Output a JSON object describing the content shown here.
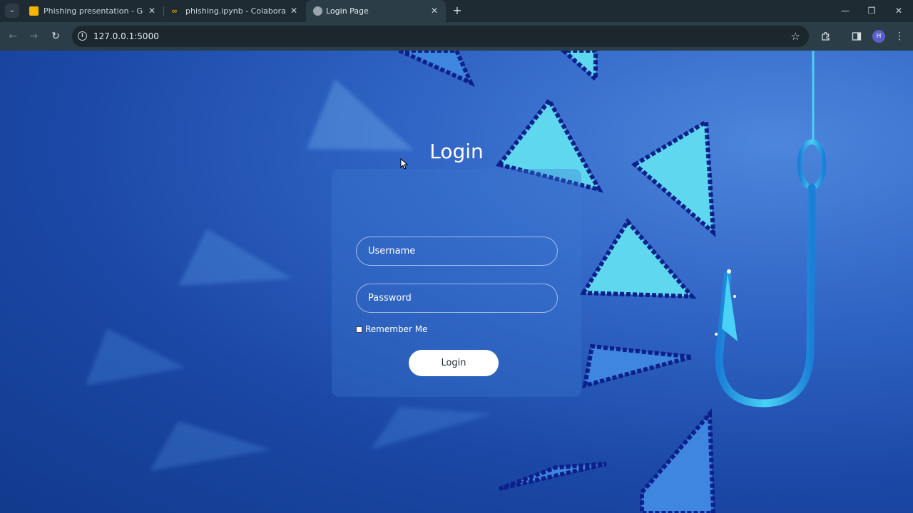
{
  "browser": {
    "tabs": [
      {
        "title": "Phishing presentation - Google",
        "favicon_color": "#f4b400",
        "active": false
      },
      {
        "title": "phishing.ipynb - Colaboratory",
        "favicon_color": "#f9ab00",
        "active": false
      },
      {
        "title": "Login Page",
        "favicon_color": "#9aa6ae",
        "active": true
      }
    ],
    "address": "127.0.0.1:5000",
    "profile_initial": "H"
  },
  "login": {
    "title": "Login",
    "username_placeholder": "Username",
    "password_placeholder": "Password",
    "remember_label": "Remember Me",
    "submit_label": "Login"
  },
  "icons": {
    "tab_search": "chevron-down-icon",
    "back": "arrow-left-icon",
    "forward": "arrow-right-icon",
    "reload": "reload-icon",
    "site_info": "info-icon",
    "bookmark": "star-icon",
    "extensions": "puzzle-icon",
    "side_panel": "side-panel-icon",
    "menu": "kebab-menu-icon"
  },
  "colors": {
    "accent": "#2f63c4",
    "cursor_cyan": "#5fd7ef",
    "cursor_dark": "#0c1f8a",
    "hook": "#2bb3ea"
  }
}
